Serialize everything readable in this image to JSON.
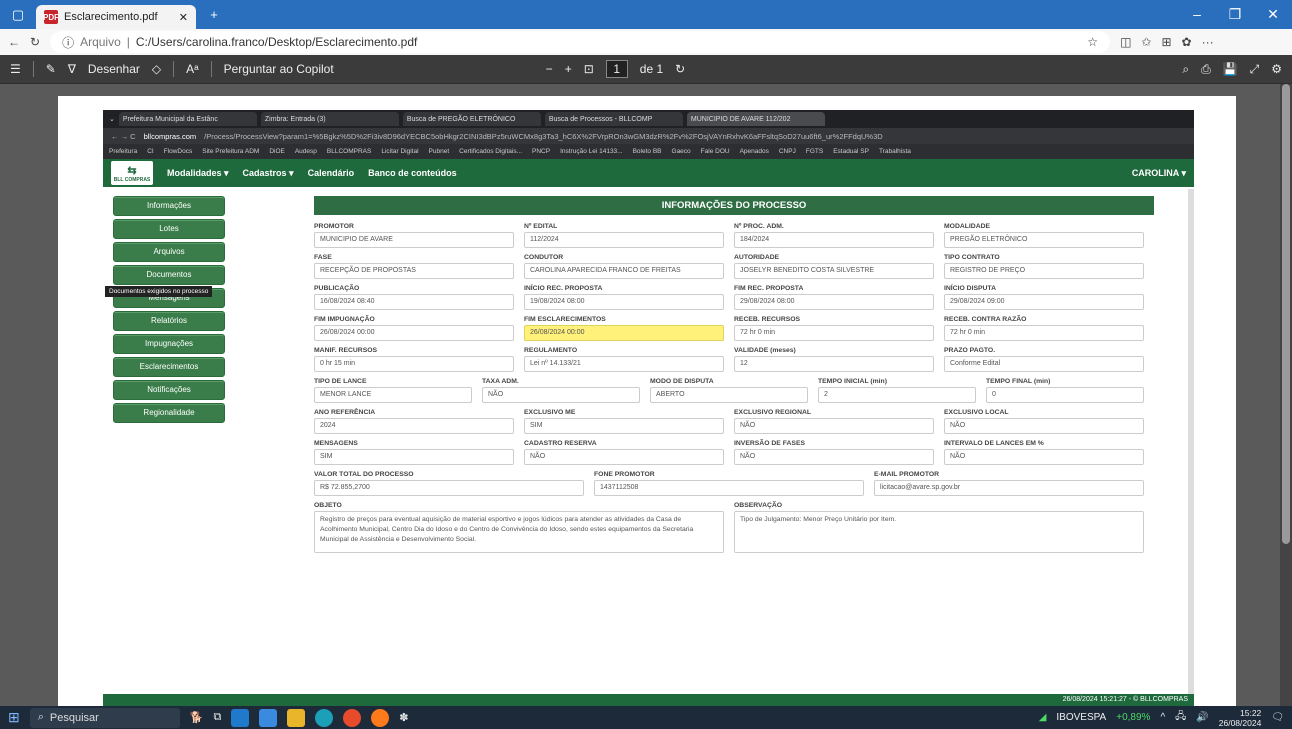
{
  "edge": {
    "tab_title": "Esclarecimento.pdf",
    "address_prefix": "Arquivo",
    "address_path": "C:/Users/carolina.franco/Desktop/Esclarecimento.pdf"
  },
  "pdf_toolbar": {
    "draw_label": "Desenhar",
    "copilot_label": "Perguntar ao Copilot",
    "page_current": "1",
    "page_total": "de 1"
  },
  "inner_browser": {
    "tabs": [
      "Prefeitura Municipal da Estânc",
      "Zimbra: Entrada (3)",
      "Busca de PREGÃO ELETRÔNICO",
      "Busca de Processos - BLLCOMP",
      "MUNICIPIO DE AVARE 112/202"
    ],
    "url_host": "bllcompras.com",
    "url_path": "/Process/ProcessView?param1=%5Bgkz%5D%2Fi3iv8D96dYECBC5obHkgr2CINI3dBPz5ruWCMx8g3Ta3_hC6X%2FVrpROn3wGM3dzR%2Fv%2FOsjVAYnRxhvK6aFFsltqSoD27uu6ft6_ur%2FFdqU%3D",
    "bookmarks": [
      "Prefeitura",
      "CI",
      "FlowDocs",
      "Site Prefeitura ADM",
      "DiOE",
      "Audesp",
      "BLLCOMPRAS",
      "Licitar Digital",
      "Pubnet",
      "Certificados Digitais...",
      "PNCP",
      "Instrução Lei 14133...",
      "Boleto BB",
      "Gaeco",
      "Fale DOU",
      "Apenados",
      "CNPJ",
      "FGTS",
      "Estadual SP",
      "Trabalhista"
    ]
  },
  "site_nav": {
    "logo_text": "BLL COMPRAS",
    "menu": [
      "Modalidades ▾",
      "Cadastros ▾",
      "Calendário",
      "Banco de conteúdos"
    ],
    "user": "CAROLINA ▾"
  },
  "sidebar": {
    "items": [
      "Informações",
      "Lotes",
      "Arquivos",
      "Documentos",
      "Mensagens",
      "Relatórios",
      "Impugnações",
      "Esclarecimentos",
      "Notificações",
      "Regionalidade"
    ],
    "tooltip": "Documentos exigidos no processo"
  },
  "process": {
    "header": "INFORMAÇÕES DO PROCESSO",
    "rows": [
      [
        {
          "l": "PROMOTOR",
          "v": "MUNICIPIO DE AVARE"
        },
        {
          "l": "Nº EDITAL",
          "v": "112/2024"
        },
        {
          "l": "Nº PROC. ADM.",
          "v": "184/2024"
        },
        {
          "l": "MODALIDADE",
          "v": "PREGÃO ELETRÔNICO"
        }
      ],
      [
        {
          "l": "FASE",
          "v": "RECEPÇÃO DE PROPOSTAS"
        },
        {
          "l": "CONDUTOR",
          "v": "CAROLINA APARECIDA FRANCO DE FREITAS"
        },
        {
          "l": "AUTORIDADE",
          "v": "JOSELYR BENEDITO COSTA SILVESTRE"
        },
        {
          "l": "TIPO CONTRATO",
          "v": "REGISTRO DE PREÇO"
        }
      ],
      [
        {
          "l": "PUBLICAÇÃO",
          "v": "16/08/2024 08:40"
        },
        {
          "l": "INÍCIO REC. PROPOSTA",
          "v": "19/08/2024 08:00"
        },
        {
          "l": "FIM REC. PROPOSTA",
          "v": "29/08/2024 08:00"
        },
        {
          "l": "INÍCIO DISPUTA",
          "v": "29/08/2024 09:00"
        }
      ],
      [
        {
          "l": "FIM IMPUGNAÇÃO",
          "v": "26/08/2024 00:00"
        },
        {
          "l": "FIM ESCLARECIMENTOS",
          "v": "26/08/2024 00:00",
          "hl": true
        },
        {
          "l": "RECEB. RECURSOS",
          "v": "72 hr 0 min"
        },
        {
          "l": "RECEB. CONTRA RAZÃO",
          "v": "72 hr 0 min"
        }
      ],
      [
        {
          "l": "MANIF. RECURSOS",
          "v": "0 hr 15 min"
        },
        {
          "l": "REGULAMENTO",
          "v": "Lei nº 14.133/21"
        },
        {
          "l": "VALIDADE (meses)",
          "v": "12"
        },
        {
          "l": "PRAZO PAGTO.",
          "v": "Conforme Edital"
        }
      ],
      [
        {
          "l": "TIPO DE LANCE",
          "v": "MENOR LANCE"
        },
        {
          "l": "TAXA ADM.",
          "v": "NÃO"
        },
        {
          "l": "MODO DE DISPUTA",
          "v": "ABERTO"
        },
        {
          "l": "TEMPO INICIAL (min)",
          "v": "2"
        },
        {
          "l": "TEMPO FINAL (min)",
          "v": "0"
        }
      ],
      [
        {
          "l": "ANO REFERÊNCIA",
          "v": "2024"
        },
        {
          "l": "EXCLUSIVO ME",
          "v": "SIM"
        },
        {
          "l": "EXCLUSIVO REGIONAL",
          "v": "NÃO"
        },
        {
          "l": "EXCLUSIVO LOCAL",
          "v": "NÃO"
        }
      ],
      [
        {
          "l": "MENSAGENS",
          "v": "SIM"
        },
        {
          "l": "CADASTRO RESERVA",
          "v": "NÃO"
        },
        {
          "l": "INVERSÃO DE FASES",
          "v": "NÃO"
        },
        {
          "l": "INTERVALO DE LANCES EM %",
          "v": "NÃO"
        }
      ],
      [
        {
          "l": "VALOR TOTAL DO PROCESSO",
          "v": "R$ 72.855,2700"
        },
        {
          "l": "FONE PROMOTOR",
          "v": "1437112508"
        },
        {
          "l": "E-MAIL PROMOTOR",
          "v": "licitacao@avare.sp.gov.br"
        }
      ]
    ],
    "objeto_label": "OBJETO",
    "objeto": "Registro de preços para eventual aquisição de material esportivo e jogos lúdicos para atender as atividades da Casa de Acolhimento Municipal, Centro Dia do Idoso e do Centro de Convivência do Idoso, sendo estes equipamentos da Secretaria Municipal de Assistência e Desenvolvimento Social.",
    "obs_label": "OBSERVAÇÃO",
    "observacao": "Tipo de Julgamento: Menor Preço Unitário por Item."
  },
  "inner_footer": "26/08/2024 15:21:27 - © BLLCOMPRAS",
  "taskbar": {
    "search": "Pesquisar",
    "ticker": "IBOVESPA",
    "ticker_change": "+0,89%",
    "time": "15:22",
    "date": "26/08/2024"
  }
}
